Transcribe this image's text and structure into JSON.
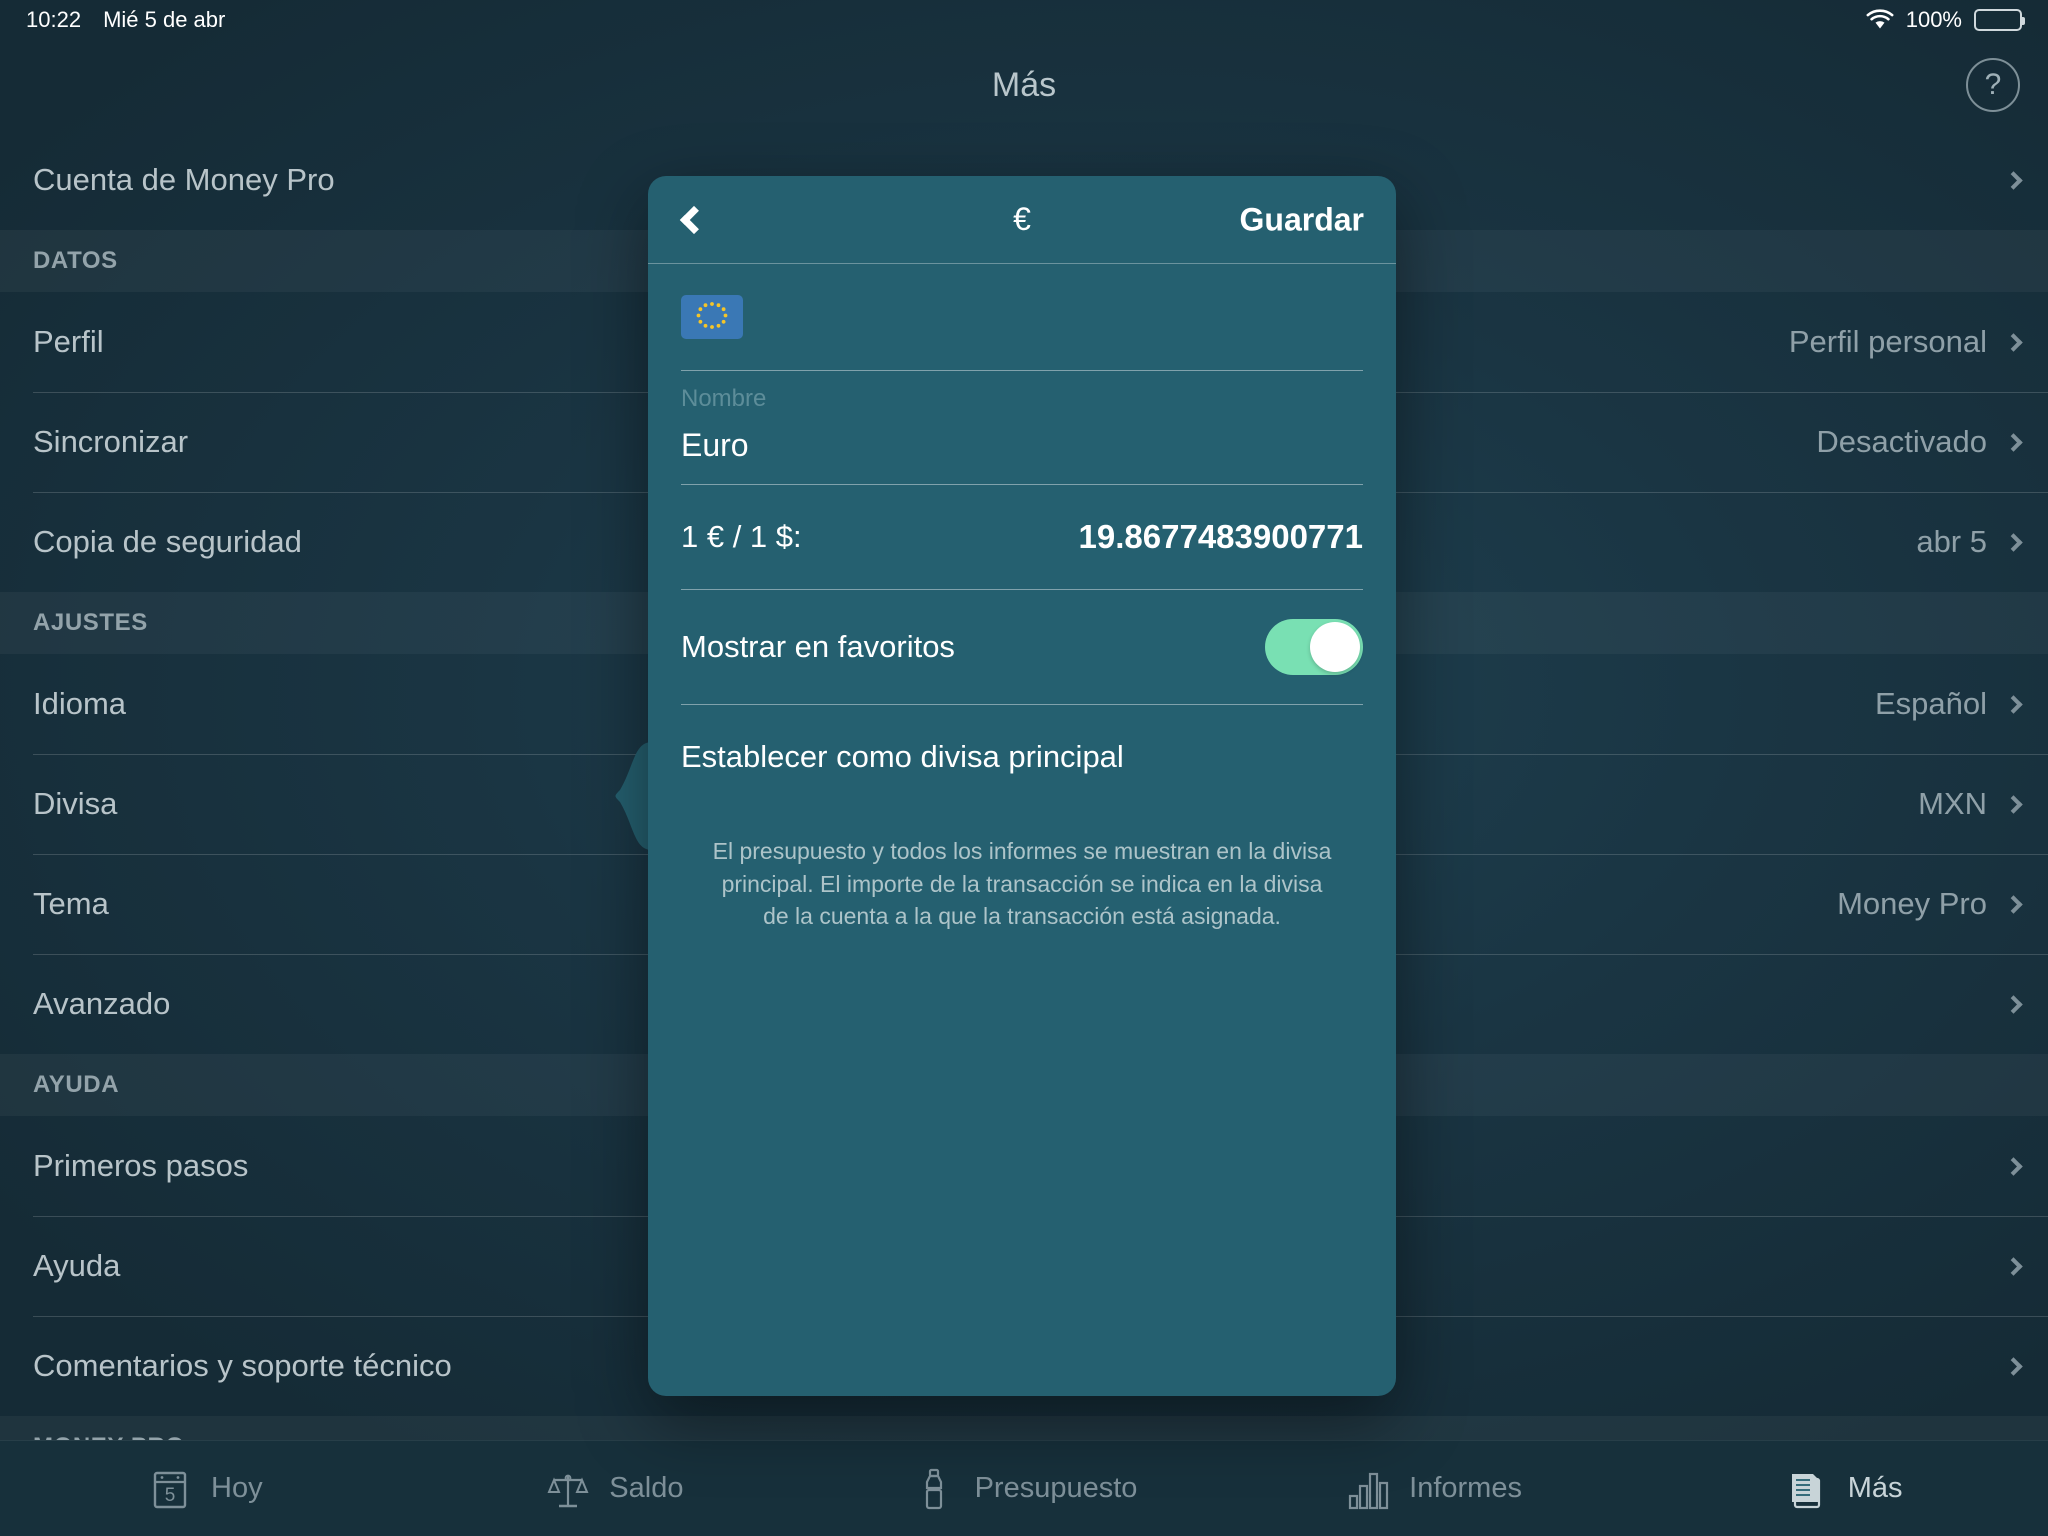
{
  "statusbar": {
    "time": "10:22",
    "date": "Mié 5 de abr",
    "battery_pct": "100%",
    "wifi_icon": "wifi-icon",
    "battery_icon": "battery-full-icon"
  },
  "navbar": {
    "title": "Más",
    "help_icon": "question-circle-icon"
  },
  "settings": {
    "account_row": {
      "label": "Cuenta de Money Pro",
      "value": ""
    },
    "sections": [
      {
        "header": "DATOS",
        "rows": [
          {
            "label": "Perfil",
            "value": "Perfil personal"
          },
          {
            "label": "Sincronizar",
            "value": "Desactivado"
          },
          {
            "label": "Copia de seguridad",
            "value": "abr 5"
          }
        ]
      },
      {
        "header": "AJUSTES",
        "rows": [
          {
            "label": "Idioma",
            "value": "Español"
          },
          {
            "label": "Divisa",
            "value": "MXN"
          },
          {
            "label": "Tema",
            "value": "Money Pro"
          },
          {
            "label": "Avanzado",
            "value": ""
          }
        ]
      },
      {
        "header": "AYUDA",
        "rows": [
          {
            "label": "Primeros pasos",
            "value": ""
          },
          {
            "label": "Ayuda",
            "value": ""
          },
          {
            "label": "Comentarios y soporte técnico",
            "value": ""
          }
        ]
      },
      {
        "header": "MONEY PRO",
        "rows": []
      }
    ]
  },
  "popover": {
    "back_icon": "chevron-left-icon",
    "title": "€",
    "save_label": "Guardar",
    "flag_icon": "eu-flag-icon",
    "name_label": "Nombre",
    "name_value": "Euro",
    "rate_label": "1 € / 1 $:",
    "rate_value": "19.8677483900771",
    "favorites_label": "Mostrar en favoritos",
    "favorites_on": true,
    "set_main_label": "Establecer como divisa principal",
    "note": "El presupuesto y todos los informes se muestran en la divisa principal. El importe de la transacción se indica en la divisa de la cuenta a la que la transacción está asignada."
  },
  "tabbar": {
    "tabs": [
      {
        "label": "Hoy",
        "icon": "calendar-icon",
        "day": "5",
        "active": false
      },
      {
        "label": "Saldo",
        "icon": "scales-icon",
        "active": false
      },
      {
        "label": "Presupuesto",
        "icon": "bottle-icon",
        "active": false
      },
      {
        "label": "Informes",
        "icon": "bar-chart-icon",
        "active": false
      },
      {
        "label": "Más",
        "icon": "documents-icon",
        "active": true
      }
    ]
  },
  "colors": {
    "background": "#1a3543",
    "popover": "#256070",
    "toggle_on": "#79e0b3",
    "accent_text": "#ffffff",
    "muted_text": "#8fa0a8"
  }
}
